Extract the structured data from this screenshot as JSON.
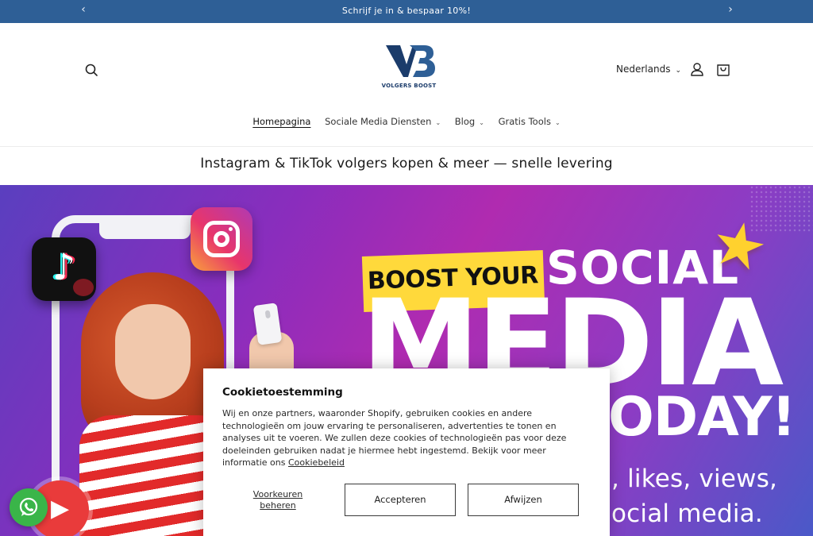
{
  "announcement": {
    "message": "Schrijf je in & bespaar 10%!",
    "prev_icon": "chevron-left-icon",
    "next_icon": "chevron-right-icon"
  },
  "header": {
    "logo_text": "VOLGERS BOOST",
    "logo_monogram": "VB",
    "language": "Nederlands",
    "search_icon": "search-icon",
    "account_icon": "user-icon",
    "cart_icon": "cart-icon"
  },
  "nav": {
    "items": [
      {
        "label": "Homepagina",
        "active": true,
        "dropdown": false
      },
      {
        "label": "Sociale Media Diensten",
        "active": false,
        "dropdown": true
      },
      {
        "label": "Blog",
        "active": false,
        "dropdown": true
      },
      {
        "label": "Gratis Tools",
        "active": false,
        "dropdown": true
      }
    ]
  },
  "page_heading": "Instagram & TikTok volgers kopen & meer — snelle levering",
  "hero": {
    "boost": "BOOST YOUR",
    "social": "SOCIAL",
    "media": "MEDIA",
    "today": "ODAY!",
    "line1": ", likes, views,",
    "line2": "ocial media."
  },
  "cookie_dialog": {
    "title": "Cookietoestemming",
    "body": "Wij en onze partners, waaronder Shopify, gebruiken cookies en andere technologieën om jouw ervaring te personaliseren, advertenties te tonen en analyses uit te voeren. We zullen deze cookies of technologieën pas voor deze doeleinden gebruiken nadat je hiermee hebt ingestemd. Bekijk voor meer informatie ons",
    "link": "Cookiebeleid",
    "preferences": "Voorkeuren beheren",
    "accept": "Accepteren",
    "reject": "Afwijzen"
  },
  "floating": {
    "whatsapp_icon": "whatsapp-icon"
  },
  "colors": {
    "announcement_bg": "#2e5f96",
    "brand_blue": "#1b3c6b",
    "hero_yellow": "#ffd93b",
    "whatsapp_green": "#3ab549"
  }
}
